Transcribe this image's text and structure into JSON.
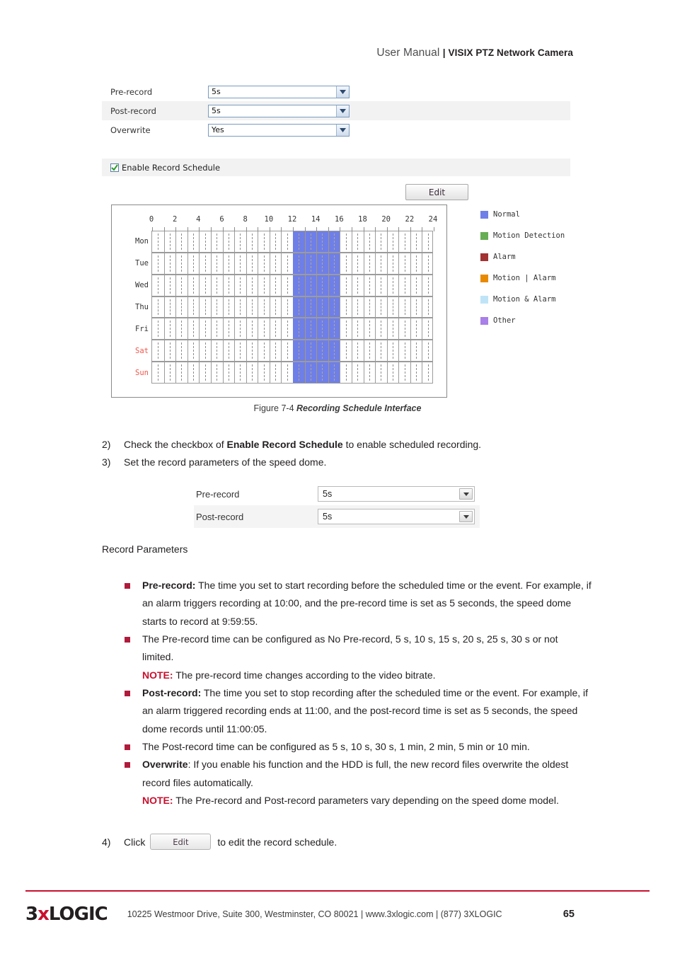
{
  "header": {
    "title_light": "User Manual",
    "separator": "| ",
    "title_bold": "VISIX PTZ Network Camera"
  },
  "record_settings_panel": {
    "rows": [
      {
        "label": "Pre-record",
        "value": "5s"
      },
      {
        "label": "Post-record",
        "value": "5s"
      },
      {
        "label": "Overwrite",
        "value": "Yes"
      }
    ],
    "enable_schedule_label": "Enable Record Schedule",
    "enable_schedule_checked": true,
    "edit_button": "Edit"
  },
  "chart_data": {
    "type": "heatmap",
    "title": "Recording Schedule",
    "xlabel": "",
    "ylabel": "",
    "xlim": [
      0,
      24
    ],
    "x_ticks": [
      0,
      2,
      4,
      6,
      8,
      10,
      12,
      14,
      16,
      18,
      20,
      22,
      24
    ],
    "x_tick_labels": [
      "0",
      "2",
      "4",
      "6",
      "8",
      "10",
      "12",
      "14",
      "16",
      "18",
      "20",
      "22",
      "24"
    ],
    "categories": [
      "Mon",
      "Tue",
      "Wed",
      "Thu",
      "Fri",
      "Sat",
      "Sun"
    ],
    "weekend_categories": [
      "Sat",
      "Sun"
    ],
    "grid": true,
    "legend_position": "right",
    "legend": [
      {
        "label": "Normal",
        "color": "#6f7fe8"
      },
      {
        "label": "Motion Detection",
        "color": "#67ad54"
      },
      {
        "label": "Alarm",
        "color": "#a33232"
      },
      {
        "label": "Motion | Alarm",
        "color": "#e88a00"
      },
      {
        "label": "Motion & Alarm",
        "color": "#bfe4f7"
      },
      {
        "label": "Other",
        "color": "#a97fe8"
      }
    ],
    "series": [
      {
        "name": "Mon",
        "blocks": [
          {
            "start": 12,
            "end": 16,
            "type": "Normal",
            "color": "#6f7fe8"
          }
        ]
      },
      {
        "name": "Tue",
        "blocks": [
          {
            "start": 12,
            "end": 16,
            "type": "Normal",
            "color": "#6f7fe8"
          }
        ]
      },
      {
        "name": "Wed",
        "blocks": [
          {
            "start": 12,
            "end": 16,
            "type": "Normal",
            "color": "#6f7fe8"
          }
        ]
      },
      {
        "name": "Thu",
        "blocks": [
          {
            "start": 12,
            "end": 16,
            "type": "Normal",
            "color": "#6f7fe8"
          }
        ]
      },
      {
        "name": "Fri",
        "blocks": [
          {
            "start": 12,
            "end": 16,
            "type": "Normal",
            "color": "#6f7fe8"
          }
        ]
      },
      {
        "name": "Sat",
        "blocks": [
          {
            "start": 12,
            "end": 16,
            "type": "Normal",
            "color": "#6f7fe8"
          }
        ]
      },
      {
        "name": "Sun",
        "blocks": [
          {
            "start": 12,
            "end": 16,
            "type": "Normal",
            "color": "#6f7fe8"
          }
        ]
      }
    ]
  },
  "figure_caption": {
    "number": "Figure 7-4 ",
    "title": "Recording Schedule Interface"
  },
  "steps": {
    "step2": {
      "num": "2)",
      "pre": "Check the checkbox of ",
      "bold": "Enable Record Schedule",
      "post": " to enable scheduled recording."
    },
    "step3": {
      "num": "3)",
      "text": "Set the record parameters of the speed dome."
    },
    "step4": {
      "num": "4)",
      "pre": "Click",
      "button": "Edit",
      "post": "to edit the record schedule."
    }
  },
  "record_params_panel": {
    "rows": [
      {
        "label": "Pre-record",
        "value": "5s"
      },
      {
        "label": "Post-record",
        "value": "5s"
      }
    ]
  },
  "section_title": "Record Parameters",
  "bullets": [
    {
      "bold": "Pre-record:",
      "text": " The time you set to start recording before the scheduled time or the event. For example, if an alarm triggers recording at 10:00, and the pre-record time is set as 5 seconds, the speed dome starts to record at 9:59:55."
    },
    {
      "bold": "",
      "text": "The Pre-record time can be configured as No Pre-record, 5 s, 10 s, 15 s, 20 s, 25 s, 30 s or not limited.",
      "note_label": "NOTE:",
      "note_text": " The pre-record time changes according to the video bitrate."
    },
    {
      "bold": "Post-record:",
      "text": " The time you set to stop recording after the scheduled time or the event. For example, if an alarm triggered recording ends at 11:00, and the post-record time is set as 5 seconds, the speed dome records until 11:00:05."
    },
    {
      "bold": "",
      "text": "The Post-record time can be configured as 5 s, 10 s, 30 s, 1 min, 2 min, 5 min or 10 min."
    },
    {
      "bold": "Overwrite",
      "text": ": If you enable his function and the HDD is full, the new record files overwrite the oldest record files automatically.",
      "note_label": "NOTE:",
      "note_text": " The Pre-record and Post-record parameters vary depending on the speed dome model."
    }
  ],
  "footer": {
    "logo_pre": "3",
    "logo_x": "x",
    "logo_post": "LOGIC",
    "address": "10225 Westmoor Drive, Suite 300, Westminster, CO 80021 | www.3xlogic.com | (877) 3XLOGIC",
    "page_number": "65",
    "rule_color": "#c8102e"
  }
}
